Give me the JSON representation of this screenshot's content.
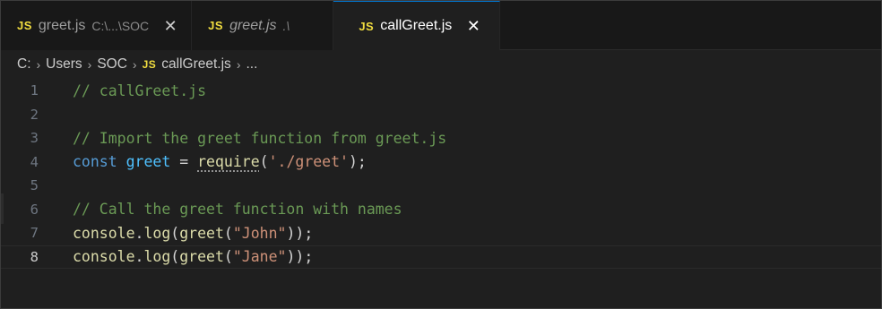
{
  "tabs": [
    {
      "badge": "JS",
      "label": "greet.js",
      "desc": "C:\\...\\SOC",
      "close": "✕"
    },
    {
      "badge": "JS",
      "label": "greet.js",
      "desc": ".\\"
    },
    {
      "badge": "JS",
      "label": "callGreet.js",
      "close": "✕"
    }
  ],
  "breadcrumb": {
    "drive": "C:",
    "sep": "›",
    "folder1": "Users",
    "folder2": "SOC",
    "badge": "JS",
    "file": "callGreet.js",
    "more": "..."
  },
  "editor": {
    "lines": [
      {
        "n": "1",
        "comment": "// callGreet.js"
      },
      {
        "n": "2"
      },
      {
        "n": "3",
        "comment": "// Import the greet function from greet.js"
      },
      {
        "n": "4",
        "kw": "const",
        "var": "greet",
        "eq": " = ",
        "fn": "require",
        "open": "(",
        "str": "'./greet'",
        "close": ");"
      },
      {
        "n": "5"
      },
      {
        "n": "6",
        "comment": "// Call the greet function with names"
      },
      {
        "n": "7",
        "obj": "console",
        "dot": ".",
        "method": "log",
        "p1": "(",
        "fn": "greet",
        "p2": "(",
        "str": "\"John\"",
        "end": "));"
      },
      {
        "n": "8",
        "obj": "console",
        "dot": ".",
        "method": "log",
        "p1": "(",
        "fn": "greet",
        "p2": "(",
        "str": "\"Jane\"",
        "end": "));"
      }
    ]
  },
  "colors": {
    "js_badge": "#f1dd3f",
    "active_tab_border": "#0078d4",
    "comment": "#6a9955",
    "keyword": "#569cd6",
    "variable": "#4fc1ff",
    "function": "#dcdcaa",
    "string": "#ce9178"
  }
}
